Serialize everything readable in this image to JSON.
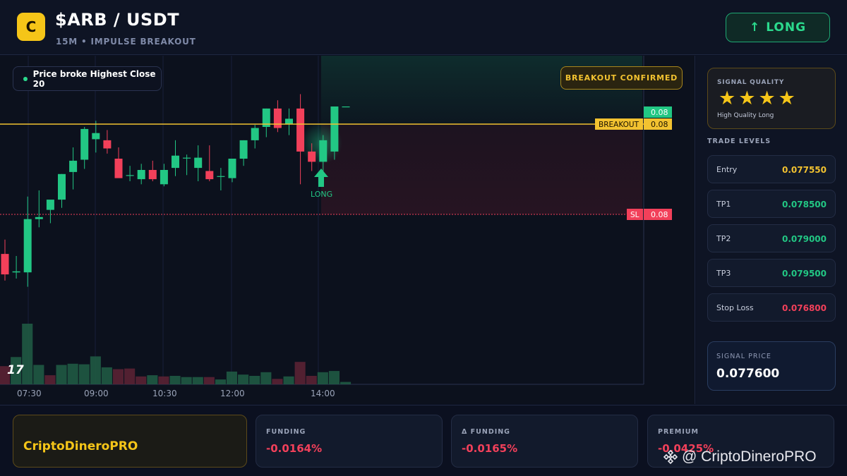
{
  "header": {
    "logo_letter": "C",
    "pair": "$ARB / USDT",
    "subtitle": "15M • IMPULSE BREAKOUT",
    "direction_arrow": "↑",
    "direction_label": "LONG"
  },
  "chart": {
    "price_pill": "Price broke Highest Close 20",
    "status_badge": "BREAKOUT CONFIRMED",
    "tv_logo": "17",
    "colors": {
      "up": "#22c784",
      "down": "#f2405a",
      "breakout": "#f2c230",
      "stop": "#f2405a"
    }
  },
  "chart_data": {
    "type": "candlestick",
    "x_ticks": [
      "07:30",
      "09:00",
      "10:30",
      "12:00",
      "14:00"
    ],
    "tags": {
      "current": "0.08",
      "breakout_label": "BREAKOUT",
      "breakout_value": "0.08",
      "sl_label": "SL",
      "sl_value": "0.08"
    },
    "signal_marker": "LONG",
    "candles": [
      {
        "o": 0.07684,
        "h": 0.07698,
        "l": 0.07658,
        "c": 0.07664
      },
      {
        "o": 0.07666,
        "h": 0.07682,
        "l": 0.0766,
        "c": 0.07667
      },
      {
        "o": 0.07666,
        "h": 0.0774,
        "l": 0.07652,
        "c": 0.07718
      },
      {
        "o": 0.07718,
        "h": 0.07746,
        "l": 0.0771,
        "c": 0.0772
      },
      {
        "o": 0.07727,
        "h": 0.07736,
        "l": 0.07714,
        "c": 0.07737
      },
      {
        "o": 0.07737,
        "h": 0.07762,
        "l": 0.07729,
        "c": 0.07762
      },
      {
        "o": 0.07764,
        "h": 0.07788,
        "l": 0.07747,
        "c": 0.07775
      },
      {
        "o": 0.07776,
        "h": 0.07808,
        "l": 0.07767,
        "c": 0.07806
      },
      {
        "o": 0.07796,
        "h": 0.07814,
        "l": 0.07783,
        "c": 0.07802
      },
      {
        "o": 0.07795,
        "h": 0.07805,
        "l": 0.07782,
        "c": 0.07787
      },
      {
        "o": 0.07777,
        "h": 0.07788,
        "l": 0.07762,
        "c": 0.07758
      },
      {
        "o": 0.07761,
        "h": 0.0777,
        "l": 0.07755,
        "c": 0.07761
      },
      {
        "o": 0.07757,
        "h": 0.07772,
        "l": 0.07752,
        "c": 0.07766
      },
      {
        "o": 0.07766,
        "h": 0.07775,
        "l": 0.07755,
        "c": 0.07757
      },
      {
        "o": 0.07752,
        "h": 0.07772,
        "l": 0.0775,
        "c": 0.07766
      },
      {
        "o": 0.07768,
        "h": 0.07795,
        "l": 0.0776,
        "c": 0.0778
      },
      {
        "o": 0.07778,
        "h": 0.07781,
        "l": 0.07761,
        "c": 0.07778
      },
      {
        "o": 0.07768,
        "h": 0.0779,
        "l": 0.07755,
        "c": 0.07778
      },
      {
        "o": 0.07765,
        "h": 0.0779,
        "l": 0.07755,
        "c": 0.07757
      },
      {
        "o": 0.0776,
        "h": 0.07768,
        "l": 0.07746,
        "c": 0.0776
      },
      {
        "o": 0.07758,
        "h": 0.07776,
        "l": 0.07754,
        "c": 0.07777
      },
      {
        "o": 0.07777,
        "h": 0.07795,
        "l": 0.0777,
        "c": 0.07795
      },
      {
        "o": 0.07795,
        "h": 0.0781,
        "l": 0.07787,
        "c": 0.07807
      },
      {
        "o": 0.07808,
        "h": 0.07826,
        "l": 0.07798,
        "c": 0.07826
      },
      {
        "o": 0.07826,
        "h": 0.07834,
        "l": 0.07803,
        "c": 0.07807
      },
      {
        "o": 0.07811,
        "h": 0.07826,
        "l": 0.078,
        "c": 0.07816
      },
      {
        "o": 0.07826,
        "h": 0.0784,
        "l": 0.07752,
        "c": 0.07784
      },
      {
        "o": 0.07784,
        "h": 0.07792,
        "l": 0.07765,
        "c": 0.07774
      },
      {
        "o": 0.07774,
        "h": 0.078,
        "l": 0.0776,
        "c": 0.07795
      },
      {
        "o": 0.07784,
        "h": 0.07828,
        "l": 0.07776,
        "c": 0.07828
      },
      {
        "o": 0.07828,
        "h": 0.07828,
        "l": 0.07828,
        "c": 0.07828
      }
    ],
    "volumes": [
      {
        "v": 0.3,
        "up": false
      },
      {
        "v": 0.45,
        "up": true
      },
      {
        "v": 1.0,
        "up": true
      },
      {
        "v": 0.32,
        "up": true
      },
      {
        "v": 0.15,
        "up": false
      },
      {
        "v": 0.32,
        "up": true
      },
      {
        "v": 0.34,
        "up": true
      },
      {
        "v": 0.33,
        "up": true
      },
      {
        "v": 0.46,
        "up": true
      },
      {
        "v": 0.28,
        "up": true
      },
      {
        "v": 0.25,
        "up": false
      },
      {
        "v": 0.26,
        "up": false
      },
      {
        "v": 0.13,
        "up": false
      },
      {
        "v": 0.15,
        "up": true
      },
      {
        "v": 0.13,
        "up": false
      },
      {
        "v": 0.14,
        "up": true
      },
      {
        "v": 0.12,
        "up": true
      },
      {
        "v": 0.12,
        "up": true
      },
      {
        "v": 0.12,
        "up": false
      },
      {
        "v": 0.08,
        "up": true
      },
      {
        "v": 0.21,
        "up": true
      },
      {
        "v": 0.16,
        "up": true
      },
      {
        "v": 0.14,
        "up": true
      },
      {
        "v": 0.2,
        "up": true
      },
      {
        "v": 0.09,
        "up": false
      },
      {
        "v": 0.13,
        "up": true
      },
      {
        "v": 0.37,
        "up": false
      },
      {
        "v": 0.14,
        "up": false
      },
      {
        "v": 0.2,
        "up": true
      },
      {
        "v": 0.22,
        "up": true
      },
      {
        "v": 0.04,
        "up": true
      }
    ]
  },
  "sidebar": {
    "quality_title": "SIGNAL QUALITY",
    "stars": "★★★★",
    "quality_sub": "High Quality Long",
    "levels_title": "TRADE LEVELS",
    "levels": [
      {
        "label": "Entry",
        "value": "0.077550",
        "color": "#f2c230"
      },
      {
        "label": "TP1",
        "value": "0.078500",
        "color": "#22c784"
      },
      {
        "label": "TP2",
        "value": "0.079000",
        "color": "#22c784"
      },
      {
        "label": "TP3",
        "value": "0.079500",
        "color": "#22c784"
      },
      {
        "label": "Stop Loss",
        "value": "0.076800",
        "color": "#f2405a"
      }
    ],
    "signal_title": "SIGNAL PRICE",
    "signal_value": "0.077600"
  },
  "footer": {
    "brand": "CriptoDineroPRO",
    "stats": [
      {
        "label": "FUNDING",
        "value": "-0.0164%"
      },
      {
        "label": "Δ FUNDING",
        "value": "-0.0165%"
      },
      {
        "label": "PREMIUM",
        "value": "-0.0425%"
      }
    ],
    "watermark": "@ CriptoDineroPRO"
  }
}
